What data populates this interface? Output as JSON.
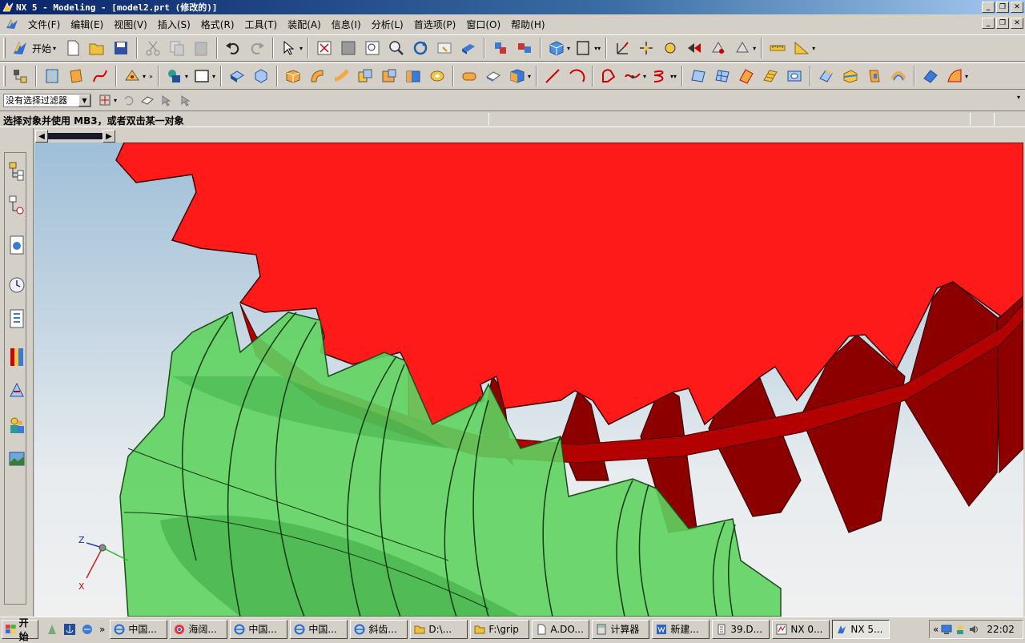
{
  "window": {
    "title": "NX 5 - Modeling - [model2.prt (修改的)]"
  },
  "menu": {
    "items": [
      "文件(F)",
      "编辑(E)",
      "视图(V)",
      "插入(S)",
      "格式(R)",
      "工具(T)",
      "装配(A)",
      "信息(I)",
      "分析(L)",
      "首选项(P)",
      "窗口(O)",
      "帮助(H)"
    ]
  },
  "toolbar": {
    "start_label": "开始",
    "more_glyph": "»"
  },
  "filter": {
    "selection_filter_value": "没有选择过滤器"
  },
  "status": {
    "prompt": "选择对象并使用 MB3，或者双击某一对象"
  },
  "triad": {
    "z_label": "Z",
    "x_label": "X"
  },
  "taskbar": {
    "start_label": "开始",
    "more_glyph": "»",
    "tasks": [
      {
        "label": "中国..."
      },
      {
        "label": "海阔..."
      },
      {
        "label": "中国..."
      },
      {
        "label": "中国..."
      },
      {
        "label": "斜齿..."
      },
      {
        "label": "D:\\..."
      },
      {
        "label": "F:\\grip"
      },
      {
        "label": "A.DO..."
      },
      {
        "label": "计算器"
      },
      {
        "label": "新建..."
      },
      {
        "label": "39.D..."
      },
      {
        "label": "NX 0..."
      },
      {
        "label": "NX 5..."
      }
    ],
    "tray_arrow": "«",
    "clock": "22:02"
  },
  "colors": {
    "gear_red": "#ff1a1a",
    "gear_dark": "#8c0000",
    "worm_green": "#5fd35f",
    "title_blue": "#0a246a"
  }
}
